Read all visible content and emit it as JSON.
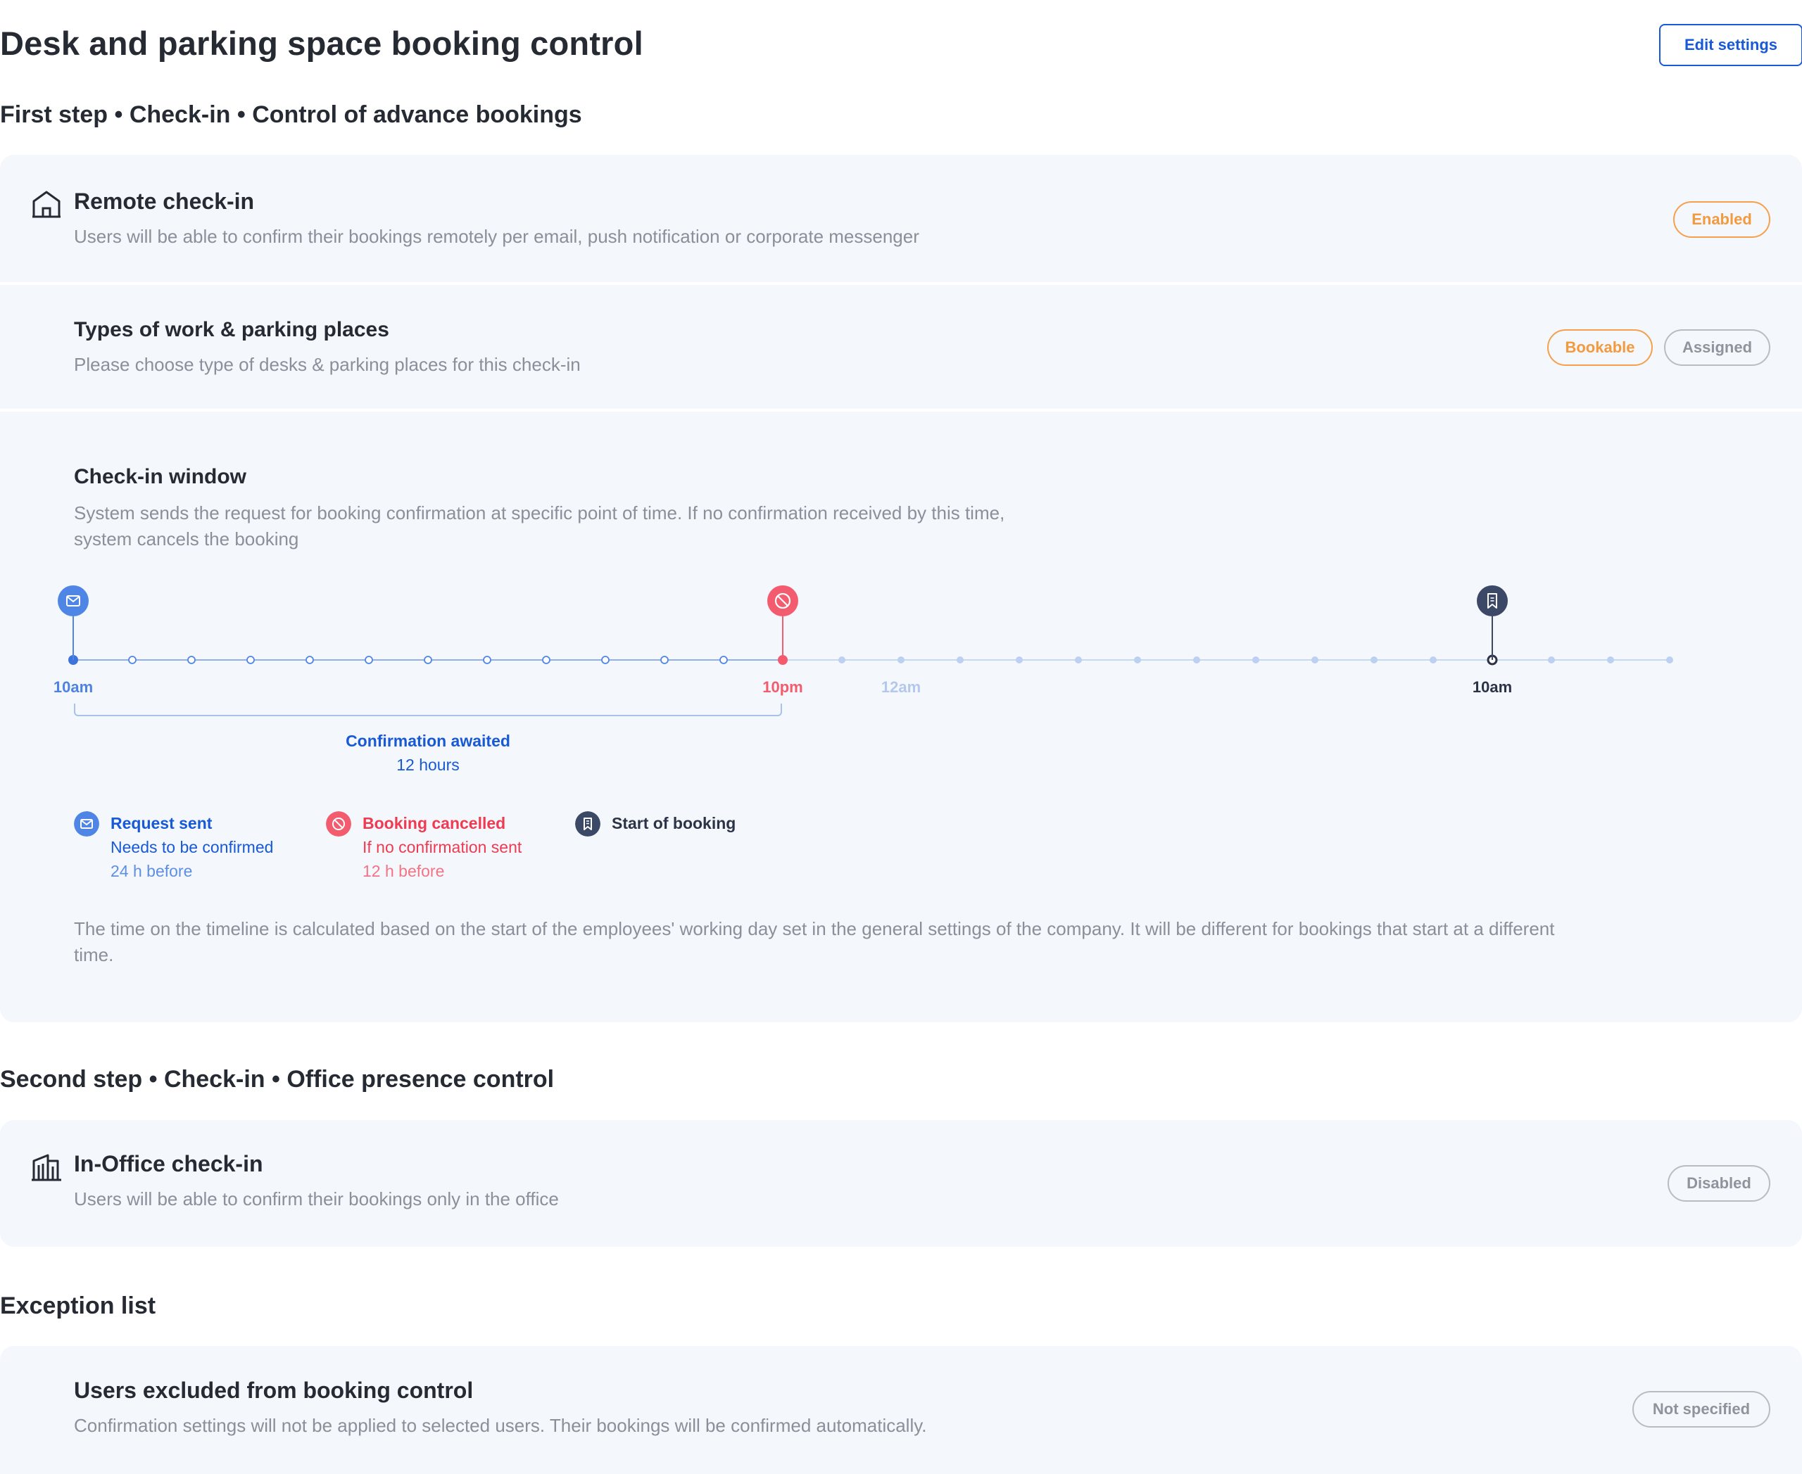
{
  "page": {
    "title": "Desk and parking space booking control",
    "edit_button": "Edit settings"
  },
  "colors": {
    "primary": "#1759d6",
    "accent_orange": "#f39a3e",
    "danger": "#f25c6e",
    "dark": "#3b4866",
    "panel_bg": "#f4f7fc"
  },
  "first_step": {
    "title": "First step • Check-in • Control of advance bookings",
    "remote_checkin": {
      "icon": "home-icon",
      "title": "Remote check-in",
      "description": "Users will be able to confirm their bookings remotely per email, push notification or corporate messenger",
      "status": "Enabled"
    },
    "place_types": {
      "title": "Types of work & parking places",
      "description": "Please choose type of desks & parking places for this check-in",
      "options": [
        {
          "label": "Bookable",
          "selected": true
        },
        {
          "label": "Assigned",
          "selected": false
        }
      ]
    },
    "checkin_window": {
      "title": "Check-in window",
      "description_line1": "System sends the request for booking confirmation at specific point of time. If no confirmation received by this time,",
      "description_line2": "system cancels the booking",
      "timeline": {
        "total_steps": 28,
        "request_step": 0,
        "cancel_step": 12,
        "booking_step": 24,
        "labels": [
          {
            "text": "10am",
            "step": 0,
            "color": "#4e83e0"
          },
          {
            "text": "10pm",
            "step": 12,
            "color": "#f25c6e"
          },
          {
            "text": "12am",
            "step": 14,
            "color": "#b4c8ec"
          },
          {
            "text": "10am",
            "step": 24,
            "color": "#2c3347"
          }
        ]
      },
      "confirmation": {
        "title": "Confirmation awaited",
        "duration": "12 hours"
      },
      "legend": [
        {
          "icon": "mail-icon",
          "title": "Request sent",
          "line1": "Needs to be confirmed",
          "line2": "24 h before"
        },
        {
          "icon": "cancel-icon",
          "title": "Booking cancelled",
          "line1": "If no confirmation sent",
          "line2": "12 h before"
        },
        {
          "icon": "bookmark-icon",
          "title": "Start of booking"
        }
      ],
      "note_line1": "The time on the timeline is calculated based on the start of the employees' working day set in the general settings of the company. It will be different for bookings that start at a different",
      "note_line2": "time."
    }
  },
  "second_step": {
    "title": "Second step • Check-in • Office presence control",
    "office_checkin": {
      "icon": "building-icon",
      "title": "In-Office check-in",
      "description": "Users will be able to confirm their bookings only in the office",
      "status": "Disabled"
    }
  },
  "exceptions": {
    "title": "Exception list",
    "excluded_users": {
      "title": "Users excluded from booking control",
      "description": "Confirmation settings will not be applied to selected users. Their bookings will be confirmed automatically.",
      "status": "Not specified"
    }
  }
}
